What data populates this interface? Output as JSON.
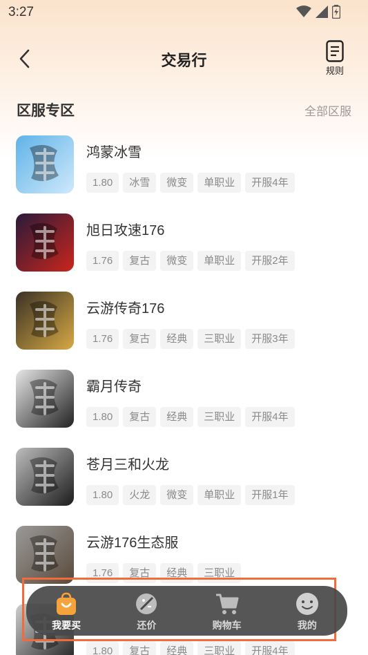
{
  "status": {
    "time": "3:27"
  },
  "header": {
    "title": "交易行",
    "rules_label": "规则"
  },
  "section": {
    "title": "区服专区",
    "all_label": "全部区服"
  },
  "games": [
    {
      "name": "鸿蒙冰雪",
      "tags": [
        "1.80",
        "冰雪",
        "微变",
        "单职业",
        "开服4年"
      ],
      "icon": "ice-dragon-icon",
      "colors": [
        "#5fb3e8",
        "#cfe9fb"
      ]
    },
    {
      "name": "旭日攻速176",
      "tags": [
        "1.76",
        "复古",
        "微变",
        "单职业",
        "开服2年"
      ],
      "icon": "sword-icon",
      "colors": [
        "#2a1a3a",
        "#c9261c"
      ]
    },
    {
      "name": "云游传奇176",
      "tags": [
        "1.76",
        "复古",
        "经典",
        "三职业",
        "开服3年"
      ],
      "icon": "yunyou-icon",
      "colors": [
        "#3a3226",
        "#d7a944"
      ]
    },
    {
      "name": "霸月传奇",
      "tags": [
        "1.80",
        "复古",
        "经典",
        "三职业",
        "开服4年"
      ],
      "icon": "dragon-icon",
      "colors": [
        "#e6e6e6",
        "#222222"
      ]
    },
    {
      "name": "苍月三和火龙",
      "tags": [
        "1.80",
        "火龙",
        "微变",
        "单职业",
        "开服1年"
      ],
      "icon": "fire-dragon-icon",
      "colors": [
        "#bdbdbd",
        "#1c1c1c"
      ]
    },
    {
      "name": "云游176生态服",
      "tags": [
        "1.76",
        "复古",
        "经典",
        "三职业"
      ],
      "icon": "yunyou-stone-icon",
      "colors": [
        "#9a9a9a",
        "#5a4a3a"
      ]
    },
    {
      "name": "",
      "tags": [
        "1.80",
        "复古",
        "经典",
        "三职业",
        "开服4年"
      ],
      "icon": "dragon-icon",
      "colors": [
        "#cfcfcf",
        "#222222"
      ]
    }
  ],
  "tabbar": [
    {
      "label": "我要买",
      "icon": "shopping-bag-icon",
      "active": true
    },
    {
      "label": "还价",
      "icon": "bargain-icon",
      "active": false
    },
    {
      "label": "购物车",
      "icon": "cart-icon",
      "active": false
    },
    {
      "label": "我的",
      "icon": "smiley-icon",
      "active": false
    }
  ],
  "colors": {
    "accent": "#f5a33a",
    "highlight_border": "#f26b3a",
    "tabbar_bg": "#484848"
  }
}
